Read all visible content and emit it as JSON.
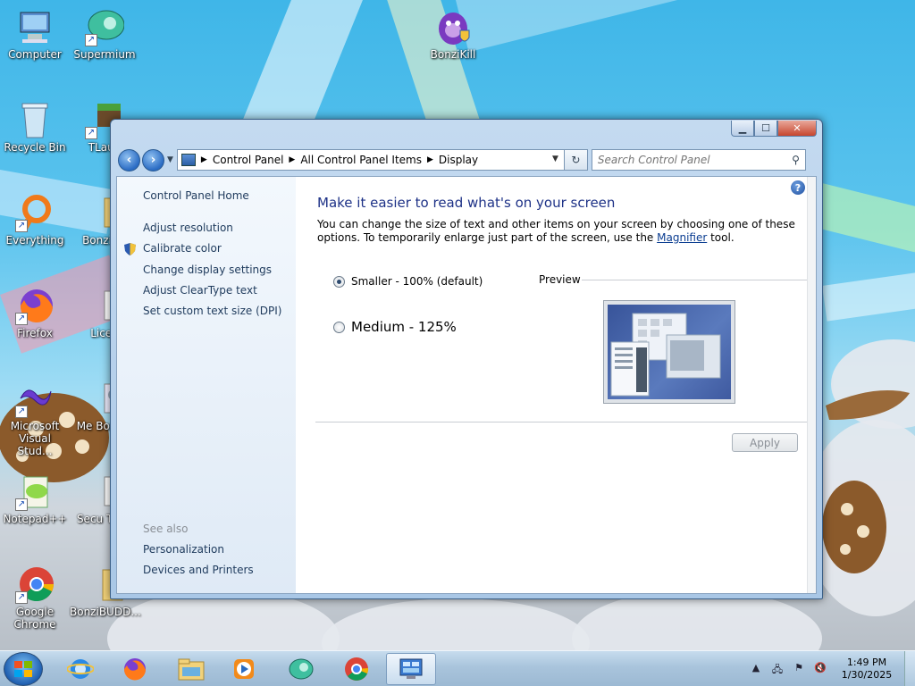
{
  "desktop": {
    "icons": [
      {
        "label": "Computer"
      },
      {
        "label": "Supermium"
      },
      {
        "label": "BonziKill"
      },
      {
        "label": "Recycle Bin"
      },
      {
        "label": "TLaun"
      },
      {
        "label": "Everything"
      },
      {
        "label": "BonziBU"
      },
      {
        "label": "Firefox"
      },
      {
        "label": "Licen"
      },
      {
        "label": "Microsoft Visual Stud..."
      },
      {
        "label": "Me BonziB"
      },
      {
        "label": "Notepad++"
      },
      {
        "label": "Secu Term"
      },
      {
        "label": "Google Chrome"
      },
      {
        "label": "BonziBUDD..."
      }
    ]
  },
  "window": {
    "address": {
      "crumbs": [
        "Control Panel",
        "All Control Panel Items",
        "Display"
      ]
    },
    "search": {
      "placeholder": "Search Control Panel"
    },
    "sidebar": {
      "home": "Control Panel Home",
      "links": [
        "Adjust resolution",
        "Calibrate color",
        "Change display settings",
        "Adjust ClearType text",
        "Set custom text size (DPI)"
      ],
      "see_also_title": "See also",
      "see_also": [
        "Personalization",
        "Devices and Printers"
      ]
    },
    "main": {
      "heading": "Make it easier to read what's on your screen",
      "desc_before": "You can change the size of text and other items on your screen by choosing one of these options. To temporarily enlarge just part of the screen, use the ",
      "desc_link": "Magnifier",
      "desc_after": " tool.",
      "options": [
        {
          "label": "Smaller - 100% (default)",
          "selected": true
        },
        {
          "label": "Medium - 125%",
          "selected": false
        }
      ],
      "preview_label": "Preview",
      "apply_label": "Apply"
    }
  },
  "taskbar": {
    "clock_time": "1:49 PM",
    "clock_date": "1/30/2025"
  }
}
